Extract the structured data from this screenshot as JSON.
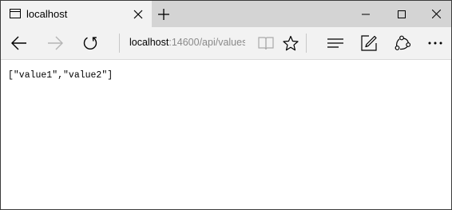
{
  "tab": {
    "title": "localhost"
  },
  "address": {
    "host": "localhost",
    "path": ":14600/api/values"
  },
  "page": {
    "body_text": "[\"value1\",\"value2\"]"
  },
  "icons": {
    "tab": "page-icon",
    "close_tab": "close-icon",
    "new_tab": "plus-icon",
    "minimize": "minimize-icon",
    "maximize": "maximize-icon",
    "close_window": "close-icon",
    "back": "arrow-left-icon",
    "forward": "arrow-right-icon",
    "refresh": "refresh-icon",
    "reading_view": "book-icon",
    "favorite": "star-icon",
    "hub": "hub-icon",
    "web_note": "pen-icon",
    "share": "share-icon",
    "more": "more-icon"
  },
  "colors": {
    "titlebar": "#d4d4d4",
    "toolbar": "#f2f2f2",
    "url_path": "#8a8a8a",
    "forward_disabled": "#b4b4b4"
  }
}
